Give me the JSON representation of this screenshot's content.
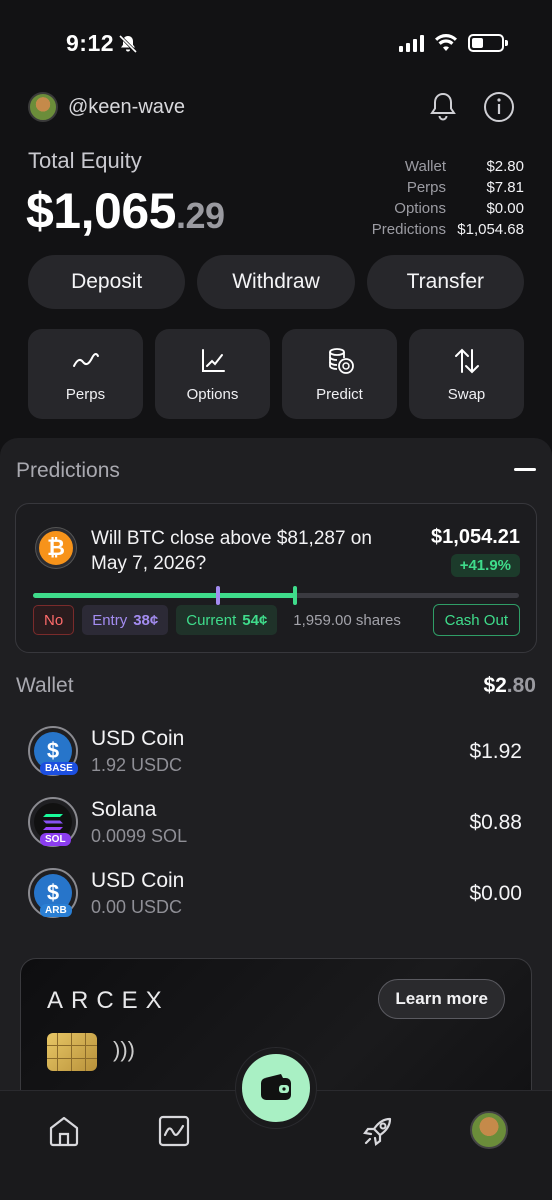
{
  "status_bar": {
    "time": "9:12"
  },
  "header": {
    "username": "@keen-wave"
  },
  "equity": {
    "label": "Total Equity",
    "whole": "$1,065",
    "cents": ".29",
    "breakdown": [
      {
        "label": "Wallet",
        "value": "$2.80"
      },
      {
        "label": "Perps",
        "value": "$7.81"
      },
      {
        "label": "Options",
        "value": "$0.00"
      },
      {
        "label": "Predictions",
        "value": "$1,054.68"
      }
    ]
  },
  "actions": {
    "deposit": "Deposit",
    "withdraw": "Withdraw",
    "transfer": "Transfer"
  },
  "tiles": [
    {
      "label": "Perps",
      "icon": "trend-line-icon"
    },
    {
      "label": "Options",
      "icon": "chart-axis-icon"
    },
    {
      "label": "Predict",
      "icon": "coin-stack-icon"
    },
    {
      "label": "Swap",
      "icon": "swap-arrows-icon"
    }
  ],
  "predictions": {
    "title": "Predictions",
    "card": {
      "question": "Will BTC close above $81,287 on May 7, 2026?",
      "amount": "$1,054.21",
      "change": "+41.9%",
      "outcome": "No",
      "entry_label": "Entry",
      "entry_value": "38¢",
      "current_label": "Current",
      "current_value": "54¢",
      "shares": "1,959.00 shares",
      "cash_out": "Cash Out",
      "entry_fraction": 0.38,
      "current_fraction": 0.54
    }
  },
  "wallet": {
    "title": "Wallet",
    "total_whole": "$2",
    "total_cents": ".80",
    "assets": [
      {
        "name": "USD Coin",
        "amount": "1.92 USDC",
        "value": "$1.92",
        "network": "BASE"
      },
      {
        "name": "Solana",
        "amount": "0.0099 SOL",
        "value": "$0.88",
        "network": "SOL"
      },
      {
        "name": "USD Coin",
        "amount": "0.00 USDC",
        "value": "$0.00",
        "network": "ARB"
      }
    ]
  },
  "promo": {
    "brand": "ARCEX",
    "button": "Learn more"
  },
  "colors": {
    "accent_green": "#3fdc8b",
    "entry_purple": "#a38cf0",
    "no_red": "#ff6b6b",
    "fab": "#a9f0c4"
  }
}
